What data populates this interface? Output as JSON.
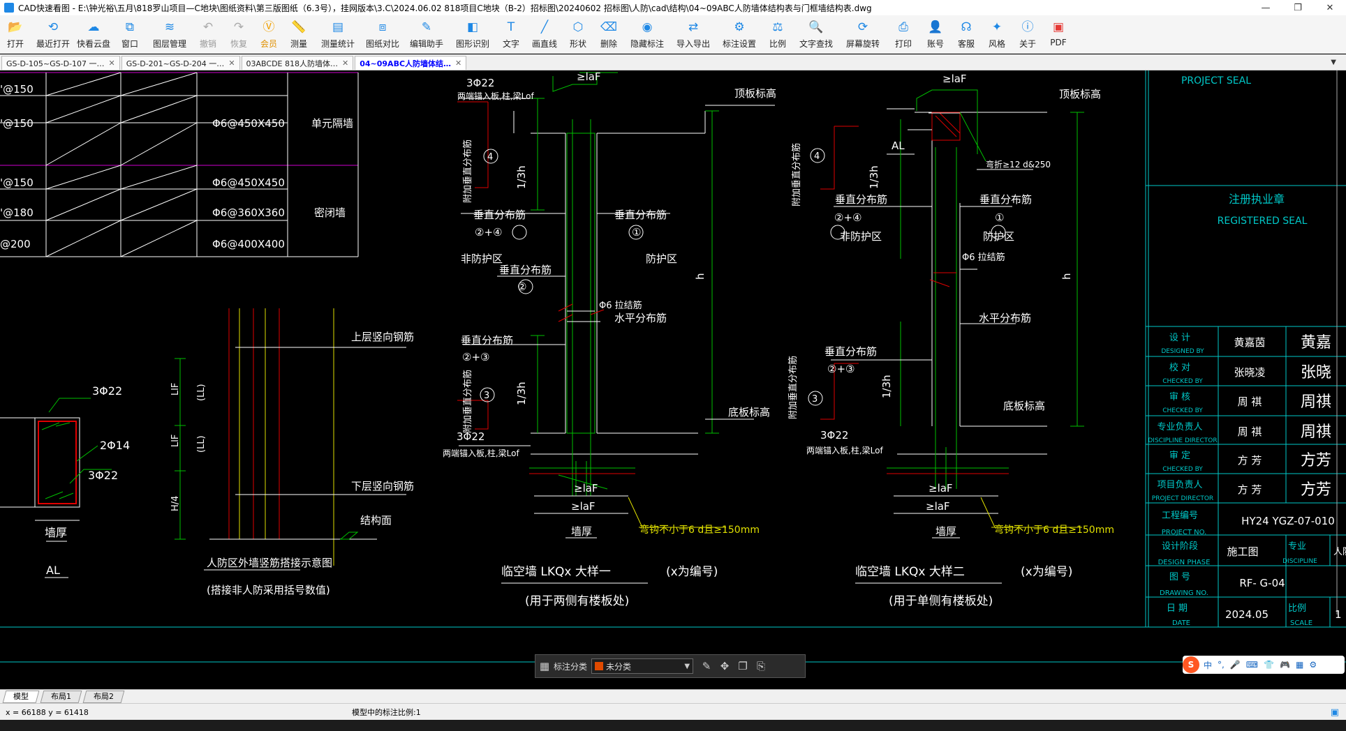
{
  "window": {
    "title": "CAD快速看图 - E:\\钟光裕\\五月\\818罗山项目—C地块\\图纸资料\\第三版图纸（6.3号），挂网版本\\3.C\\2024.06.02 818项目C地块（B-2）招标图\\20240602 招标图\\人防\\cad\\结构\\04~09ABC人防墙体结构表与门框墙结构表.dwg",
    "controls": {
      "minimize": "—",
      "restore": "❐",
      "close": "✕"
    }
  },
  "toolbar": {
    "items": [
      {
        "label": "打开",
        "icon": "folder-icon"
      },
      {
        "label": "最近打开",
        "icon": "clock-icon"
      },
      {
        "label": "快看云盘",
        "icon": "cloud-icon"
      },
      {
        "label": "窗口",
        "icon": "window-icon"
      },
      {
        "label": "图层管理",
        "icon": "layers-icon"
      },
      {
        "label": "撤销",
        "icon": "undo-icon"
      },
      {
        "label": "恢复",
        "icon": "redo-icon"
      },
      {
        "label": "会员",
        "icon": "vip-icon"
      },
      {
        "label": "测量",
        "icon": "ruler-icon"
      },
      {
        "label": "测量统计",
        "icon": "measure-stats-icon"
      },
      {
        "label": "图纸对比",
        "icon": "compare-icon"
      },
      {
        "label": "编辑助手",
        "icon": "edit-assistant-icon"
      },
      {
        "label": "图形识别",
        "icon": "shape-recognize-icon"
      },
      {
        "label": "文字",
        "icon": "text-icon"
      },
      {
        "label": "画直线",
        "icon": "line-icon"
      },
      {
        "label": "形状",
        "icon": "shape-icon"
      },
      {
        "label": "删除",
        "icon": "eraser-icon"
      },
      {
        "label": "隐藏标注",
        "icon": "eye-hide-icon"
      },
      {
        "label": "导入导出",
        "icon": "import-export-icon"
      },
      {
        "label": "标注设置",
        "icon": "annotation-settings-icon"
      },
      {
        "label": "比例",
        "icon": "scale-icon"
      },
      {
        "label": "文字查找",
        "icon": "text-search-icon"
      },
      {
        "label": "屏幕旋转",
        "icon": "rotate-screen-icon"
      },
      {
        "label": "打印",
        "icon": "printer-icon"
      },
      {
        "label": "账号",
        "icon": "user-icon"
      },
      {
        "label": "客服",
        "icon": "headset-icon"
      },
      {
        "label": "风格",
        "icon": "style-icon"
      },
      {
        "label": "关于",
        "icon": "info-icon"
      },
      {
        "label": "PDF",
        "icon": "pdf-icon"
      }
    ]
  },
  "tabs": [
    {
      "label": "GS-D-105~GS-D-107 一…",
      "active": false
    },
    {
      "label": "GS-D-201~GS-D-204 一…",
      "active": false
    },
    {
      "label": "03ABCDE 818人防墙体…",
      "active": false
    },
    {
      "label": "04~09ABC人防墙体结…",
      "active": true
    }
  ],
  "drawing": {
    "table": {
      "rows": [
        {
          "left": "'@150"
        },
        {
          "left": "'@150",
          "tie": "Φ6@450X450",
          "type": "单元隔墙"
        },
        {
          "left": "'@150",
          "tie": "Φ6@450X450"
        },
        {
          "left": "'@180",
          "tie": "Φ6@360X360",
          "type": "密闭墙"
        },
        {
          "left": "@200",
          "tie": "Φ6@400X400"
        }
      ]
    },
    "al_section": {
      "labels": [
        "3Φ22",
        "2Φ14",
        "3Φ22"
      ],
      "wall_thickness": "墙厚",
      "caption": "AL"
    },
    "lap_diagram": {
      "upper": "上层竖向钢筋",
      "lower": "下层竖向钢筋",
      "floor": "结构面",
      "dims": [
        "LlF",
        "(LL)",
        "LlF",
        "(LL)",
        "H/4"
      ],
      "title": "人防区外墙竖筋搭接示意图",
      "subtitle": "(搭接非人防采用括号数值)"
    },
    "detail1": {
      "top_bar": "3Φ22",
      "top_note": "两端锚入板,柱,梁Lof",
      "laf_top": "≥laF",
      "top_label": "顶板标高",
      "add_bar": "附加垂直分布筋",
      "n4": "4",
      "h13a": "1/3h",
      "vd1": "垂直分布筋",
      "vd1n": "②+④",
      "vd2": "垂直分布筋",
      "vd2n": "①",
      "non_protect": "非防护区",
      "protect": "防护区",
      "vd3": "垂直分布筋",
      "vd3n": "②",
      "h": "h",
      "tie": "Φ6 拉结筋",
      "horiz": "水平分布筋",
      "vd4": "垂直分布筋",
      "vd4n": "②+③",
      "add_bar2": "附加垂直分布筋",
      "n3": "3",
      "h13b": "1/3h",
      "bottom_label": "底板标高",
      "bot_bar": "3Φ22",
      "bot_note": "两端锚入板,柱,梁Lof",
      "laf_b1": "≥laF",
      "laf_b2": "≥laF",
      "hook": "弯钩不小于6 d且≥150mm",
      "wall": "墙厚",
      "title": "临空墙 LKQx 大样一",
      "title_note": "(x为编号)",
      "subtitle": "(用于两侧有楼板处)"
    },
    "detail2": {
      "laf_top": "≥laF",
      "top_label": "顶板标高",
      "al": "AL",
      "bend": "弯折≥12 d&250",
      "add_bar": "附加垂直分布筋",
      "n4": "4",
      "h13a": "1/3h",
      "vd1": "垂直分布筋",
      "vd1n": "②+④",
      "non_protect": "非防护区",
      "vd2": "垂直分布筋",
      "vd2n": "①",
      "protect": "防护区",
      "tie": "Φ6 拉结筋",
      "h": "h",
      "horiz": "水平分布筋",
      "vd3": "垂直分布筋",
      "vd3n": "②+③",
      "add_bar2": "附加垂直分布筋",
      "n3": "3",
      "h13b": "1/3h",
      "bottom_label": "底板标高",
      "bot_bar": "3Φ22",
      "bot_note": "两端锚入板,柱,梁Lof",
      "laf_b1": "≥laF",
      "laf_b2": "≥laF",
      "hook": "弯钩不小于6 d且≥150mm",
      "wall": "墙厚",
      "title": "临空墙 LKQx 大样二",
      "title_note": "(x为编号)",
      "subtitle": "(用于单侧有楼板处)"
    },
    "titleblock": {
      "project_seal": "PROJECT SEAL",
      "registered_cn": "注册执业章",
      "registered_en": "REGISTERED SEAL",
      "rows": [
        {
          "cn": "设 计",
          "en": "DESIGNED BY",
          "name": "黄嘉茵",
          "sig": "黄嘉"
        },
        {
          "cn": "校 对",
          "en": "CHECKED BY",
          "name": "张晓凌",
          "sig": "张晓"
        },
        {
          "cn": "审 核",
          "en": "CHECKED BY",
          "name": "周  祺",
          "sig": "周祺"
        },
        {
          "cn": "专业负责人",
          "en": "DISCIPLINE DIRECTOR",
          "name": "周  祺",
          "sig": "周祺"
        },
        {
          "cn": "审 定",
          "en": "CHECKED BY",
          "name": "方  芳",
          "sig": "方芳"
        },
        {
          "cn": "项目负责人",
          "en": "PROJECT DIRECTOR",
          "name": "方  芳",
          "sig": "方芳"
        }
      ],
      "project_no_cn": "工程编号",
      "project_no_en": "PROJECT NO.",
      "project_no": "HY24 YGZ-07-010",
      "phase_cn": "设计阶段",
      "phase_en": "DESIGN PHASE",
      "phase": "施工图",
      "discipline_cn": "专业",
      "discipline_en": "DISCIPLINE",
      "discipline": "人防",
      "drawing_no_cn": "图 号",
      "drawing_no_en": "DRAWING NO.",
      "drawing_no": "RF- G-04",
      "date_cn": "日 期",
      "date_en": "DATE",
      "date": "2024.05",
      "scale_cn": "比例",
      "scale_en": "SCALE",
      "scale": "1"
    }
  },
  "floatbar": {
    "label": "标注分类",
    "select": "未分类",
    "swatch": "#e04a00"
  },
  "ime": {
    "logo": "S",
    "mode": "中",
    "items": [
      "°,",
      "🎤",
      "⌨",
      "👕",
      "🎮",
      "▦",
      "⚙"
    ]
  },
  "layout_tabs": [
    "模型",
    "布局1",
    "布局2"
  ],
  "status": {
    "coord": "x = 66188  y = 61418",
    "scale": "模型中的标注比例:1"
  }
}
